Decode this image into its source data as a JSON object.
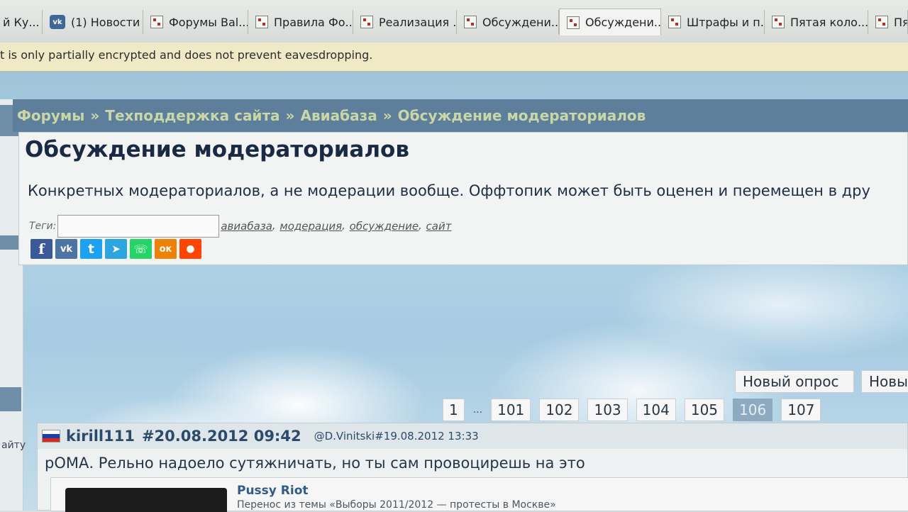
{
  "browser": {
    "tabs": [
      {
        "label": "й Ку...",
        "icon": "person-icon"
      },
      {
        "label": "(1) Новости",
        "icon": "vk-icon"
      },
      {
        "label": "Форумы Bal...",
        "icon": "forum-favicon"
      },
      {
        "label": "Правила Фо...",
        "icon": "forum-favicon"
      },
      {
        "label": "Реализация ...",
        "icon": "forum-favicon"
      },
      {
        "label": "Обсуждени...",
        "icon": "forum-favicon"
      },
      {
        "label": "Обсуждени...",
        "icon": "forum-favicon",
        "active": true
      },
      {
        "label": "Штрафы и п...",
        "icon": "forum-favicon"
      },
      {
        "label": "Пятая коло...",
        "icon": "forum-favicon"
      },
      {
        "label": "Пяты",
        "icon": "forum-favicon"
      }
    ],
    "infobar_text": "t is only partially encrypted and does not prevent eavesdropping."
  },
  "left_strip": {
    "text": "айту"
  },
  "breadcrumbs": {
    "items": [
      "Форумы",
      "Техподдержка сайта",
      "Авиабаза",
      "Обсуждение модераториалов"
    ],
    "separator": "»"
  },
  "header": {
    "title": "Обсуждение модераториалов",
    "description": "Конкретных модераториалов, а не модерации вообще. Оффтопик может быть оценен и перемещен в дру",
    "tags_label": "Теги:",
    "tags": [
      "авиабаза",
      "модерация",
      "обсуждение",
      "сайт"
    ]
  },
  "share_buttons": [
    {
      "name": "facebook-icon",
      "glyph": "f",
      "color": "#3b5998"
    },
    {
      "name": "vk-icon",
      "glyph": "vk",
      "color": "#4c75a3"
    },
    {
      "name": "twitter-icon",
      "glyph": "t",
      "color": "#1da1f2"
    },
    {
      "name": "telegram-icon",
      "glyph": "➤",
      "color": "#2ca5e0"
    },
    {
      "name": "whatsapp-icon",
      "glyph": "☏",
      "color": "#25d366"
    },
    {
      "name": "odnoklassniki-icon",
      "glyph": "ок",
      "color": "#ee8208"
    },
    {
      "name": "reddit-icon",
      "glyph": "●",
      "color": "#ff4500"
    }
  ],
  "actions": {
    "new_poll": "Новый опрос",
    "new_topic": "Новы"
  },
  "pagination": {
    "first": "1",
    "ellipsis": "...",
    "pages": [
      "101",
      "102",
      "103",
      "104",
      "105",
      "106",
      "107"
    ],
    "current": "106"
  },
  "post": {
    "author": "kirill111",
    "date": "#20.08.2012 09:42",
    "reply_to": "@D.Vinitski#19.08.2012 13:33",
    "text": "рОМА. Рельно надоело сутяжничать, но ты сам провоцирешь на это",
    "quote": {
      "title": "Pussy Riot",
      "subtitle": "Перенос из темы «Выборы 2011/2012 — протесты в Москве»"
    }
  },
  "colors": {
    "accent": "#5d7f9c",
    "breadcrumb_text": "#c9d6a6",
    "current_page": "#8eaac0"
  }
}
